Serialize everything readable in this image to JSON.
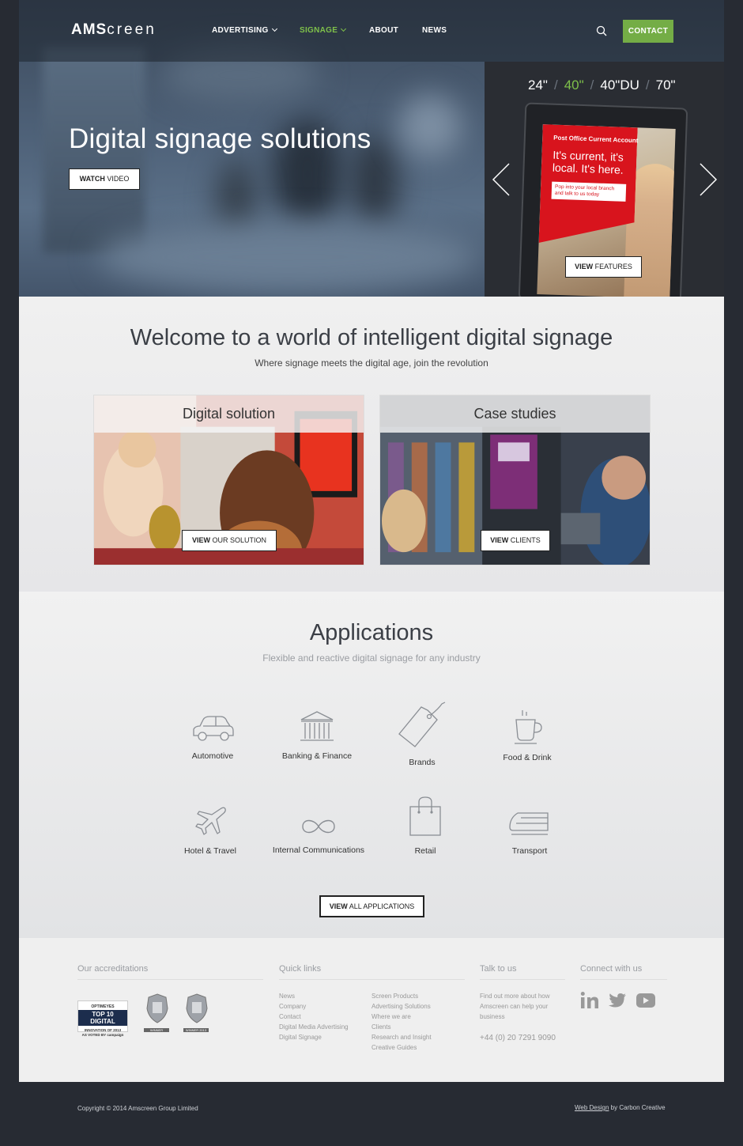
{
  "brand": {
    "logo_bold": "AMS",
    "logo_light": "creen"
  },
  "nav": {
    "items": [
      {
        "label": "ADVERTISING",
        "has_dropdown": true,
        "active": false
      },
      {
        "label": "SIGNAGE",
        "has_dropdown": true,
        "active": true
      },
      {
        "label": "ABOUT",
        "has_dropdown": false,
        "active": false
      },
      {
        "label": "NEWS",
        "has_dropdown": false,
        "active": false
      }
    ],
    "search_icon": "search-icon",
    "contact_label": "CONTACT"
  },
  "hero": {
    "title": "Digital signage solutions",
    "watch_bold": "WATCH",
    "watch_rest": " VIDEO",
    "sizes": [
      "24\"",
      "40\"",
      "40\"DU",
      "70\""
    ],
    "active_size": "40\"",
    "screen_line1": "Post Office Current Account",
    "screen_line2": "It's current, it's local. It's here.",
    "screen_line3": "Pop into your local branch and talk to us today",
    "features_bold": "VIEW",
    "features_rest": " FEATURES"
  },
  "welcome": {
    "title": "Welcome to a world of intelligent digital signage",
    "subtitle": "Where signage meets the digital age, join the revolution",
    "cards": [
      {
        "title": "Digital solution",
        "btn_bold": "VIEW",
        "btn_rest": " OUR SOLUTION"
      },
      {
        "title": "Case studies",
        "btn_bold": "VIEW",
        "btn_rest": " CLIENTS"
      }
    ]
  },
  "applications": {
    "title": "Applications",
    "subtitle": "Flexible and reactive digital signage for any industry",
    "items": [
      {
        "label": "Automotive",
        "icon": "car-icon"
      },
      {
        "label": "Banking & Finance",
        "icon": "bank-icon"
      },
      {
        "label": "Brands",
        "icon": "tag-icon"
      },
      {
        "label": "Food & Drink",
        "icon": "coffee-cup-icon"
      },
      {
        "label": "Hotel & Travel",
        "icon": "airplane-icon"
      },
      {
        "label": "Internal Communications",
        "icon": "infinity-icon"
      },
      {
        "label": "Retail",
        "icon": "shopping-bag-icon"
      },
      {
        "label": "Transport",
        "icon": "train-icon"
      }
    ],
    "view_all_bold": "VIEW",
    "view_all_rest": " ALL APPLICATIONS"
  },
  "footer": {
    "accreditations_head": "Our accreditations",
    "badge": {
      "line1": "OPTIMEYES",
      "line2": "TOP 10 DIGITAL",
      "line3": "INNOVATION OF 2013",
      "line4": "AS VOTED BY campaign"
    },
    "crest_labels": [
      "WINNER",
      "WINNER 2013"
    ],
    "quick_links_head": "Quick links",
    "links_col1": [
      "News",
      "Company",
      "Contact",
      "Digital Media Advertising",
      "Digital Signage"
    ],
    "links_col2": [
      "Screen Products",
      "Advertising Solutions",
      "Where we are",
      "Clients",
      "Research and Insight",
      "Creative Guides"
    ],
    "talk_head": "Talk to us",
    "talk_text": "Find out more about how Amscreen can help your business",
    "phone": "+44 (0) 20 7291 9090",
    "connect_head": "Connect with us",
    "social": [
      "linkedin-icon",
      "twitter-icon",
      "youtube-icon"
    ]
  },
  "bottom": {
    "copyright": "Copyright © 2014 Amscreen Group Limited",
    "credit_link": "Web Design",
    "credit_rest": " by Carbon Creative"
  },
  "colors": {
    "accent_green": "#74ad46",
    "active_nav": "#7ec04a",
    "page_bg": "#272b33",
    "screen_red": "#d8141d"
  }
}
